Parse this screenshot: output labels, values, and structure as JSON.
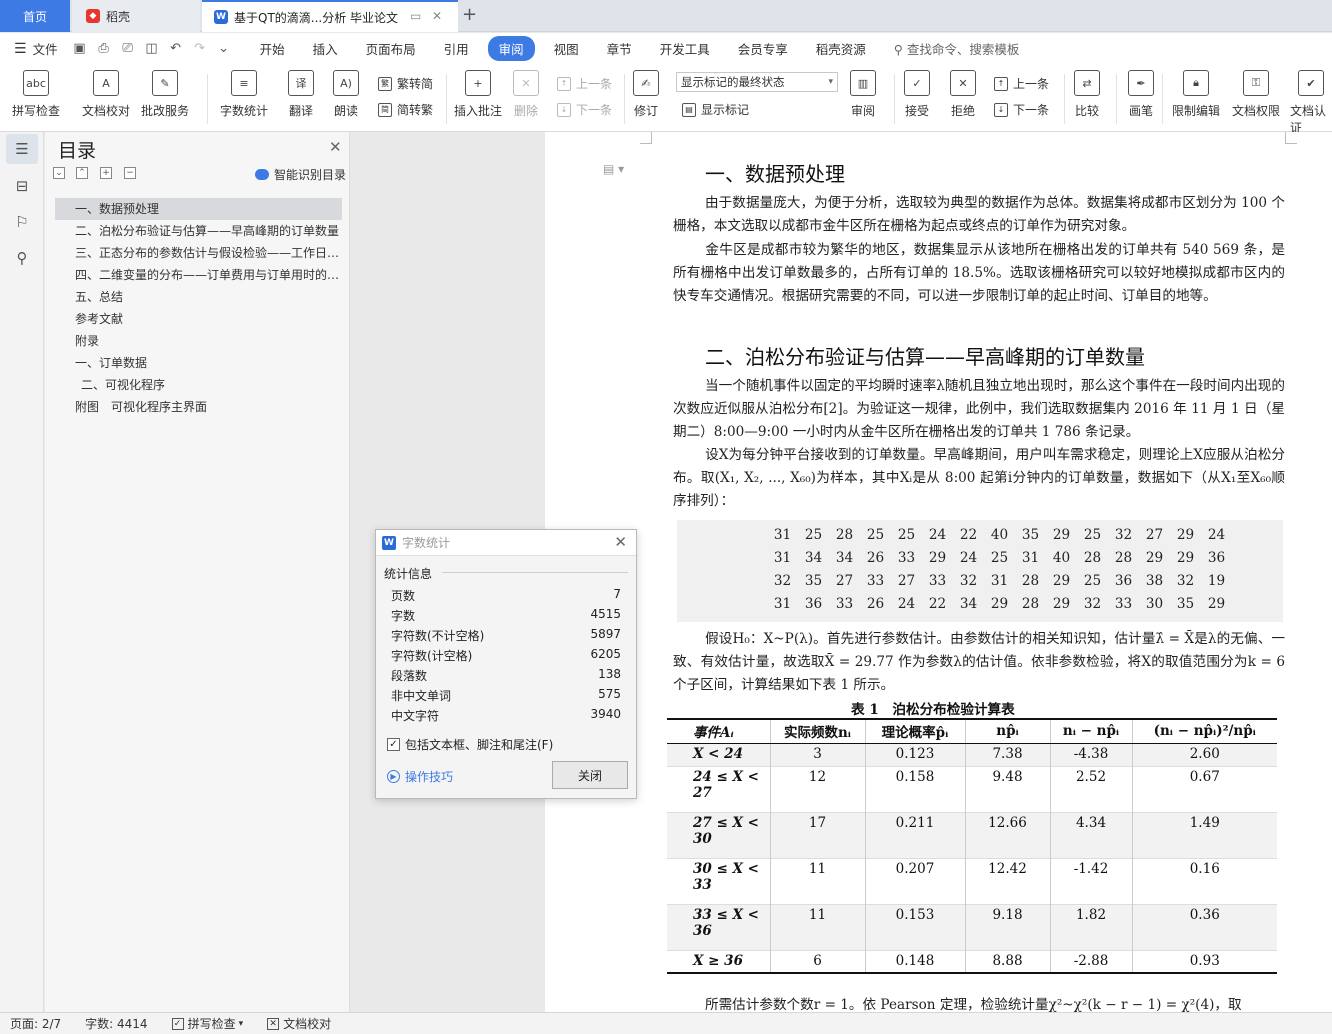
{
  "tabs": {
    "home": "首页",
    "daoke": "稻壳",
    "doc": "基于QT的滴滴...分析 毕业论文",
    "add": "+"
  },
  "menu": {
    "file": "文件",
    "items": [
      "开始",
      "插入",
      "页面布局",
      "引用",
      "审阅",
      "视图",
      "章节",
      "开发工具",
      "会员专享",
      "稻壳资源"
    ],
    "active": "审阅",
    "search": "查找命令、搜索模板"
  },
  "ribbon": {
    "spell_check": "拼写检查",
    "doc_proof": "文档校对",
    "batch_service": "批改服务",
    "word_count": "字数统计",
    "translate": "翻译",
    "read_aloud": "朗读",
    "to_traditional": "繁转简",
    "to_simplified": "简转繁",
    "insert_comment": "插入批注",
    "delete": "删除",
    "prev_comment": "上一条",
    "next_comment": "下一条",
    "revise": "修订",
    "markup_state": "显示标记的最终状态",
    "show_markup": "显示标记",
    "review": "审阅",
    "accept": "接受",
    "reject": "拒绝",
    "prev_change": "上一条",
    "next_change": "下一条",
    "compare": "比较",
    "pen": "画笔",
    "restrict_edit": "限制编辑",
    "doc_permission": "文档权限",
    "doc_auth": "文档认证"
  },
  "toc": {
    "title": "目录",
    "smart": "智能识别目录",
    "items": [
      "一、数据预处理",
      "二、泊松分布验证与估算——早高峰期的订单数量",
      "三、正态分布的参数估计与假设检验——工作日订单用时",
      "四、二维变量的分布——订单费用与订单用时的关系",
      "五、总结",
      "参考文献",
      "附录",
      "一、订单数据",
      "二、可视化程序",
      "附图　可视化程序主界面"
    ]
  },
  "doc": {
    "h1_1": "一、数据预处理",
    "p1": "由于数据量庞大，为便于分析，选取较为典型的数据作为总体。数据集将成都市区划分为 100 个栅格，本文选取以成都市金牛区所在栅格为起点或终点的订单作为研究对象。",
    "p2": "金牛区是成都市较为繁华的地区，数据集显示从该地所在栅格出发的订单共有 540 569 条，是所有栅格中出发订单数最多的，占所有订单的 18.5%。选取该栅格研究可以较好地模拟成都市区内的快专车交通情况。根据研究需要的不同，可以进一步限制订单的起止时间、订单目的地等。",
    "h1_2": "二、泊松分布验证与估算——早高峰期的订单数量",
    "p3": "当一个随机事件以固定的平均瞬时速率λ随机且独立地出现时，那么这个事件在一段时间内出现的次数应近似服从泊松分布[2]。为验证这一规律，此例中，我们选取数据集内 2016 年 11 月 1 日（星期二）8:00—9:00 一小时内从金牛区所在栅格出发的订单共 1 786 条记录。",
    "p4": "设X为每分钟平台接收到的订单数量。早高峰期间，用户叫车需求稳定，则理论上X应服从泊松分布。取(X₁, X₂, ..., X₆₀)为样本，其中Xᵢ是从 8:00 起第i分钟内的订单数量，数据如下（从X₁至X₆₀顺序排列）：",
    "data_rows": [
      [
        "31",
        "25",
        "28",
        "25",
        "25",
        "24",
        "22",
        "40",
        "35",
        "29",
        "25",
        "32",
        "27",
        "29",
        "24"
      ],
      [
        "31",
        "34",
        "34",
        "26",
        "33",
        "29",
        "24",
        "25",
        "31",
        "40",
        "28",
        "28",
        "29",
        "29",
        "36"
      ],
      [
        "32",
        "35",
        "27",
        "33",
        "27",
        "33",
        "32",
        "31",
        "28",
        "29",
        "25",
        "36",
        "38",
        "32",
        "19"
      ],
      [
        "31",
        "36",
        "33",
        "26",
        "24",
        "22",
        "34",
        "29",
        "28",
        "29",
        "32",
        "33",
        "30",
        "35",
        "29"
      ]
    ],
    "p5": "假设H₀：X~P(λ)。首先进行参数估计。由参数估计的相关知识知，估计量λ̂ = X̄是λ的无偏、一致、有效估计量，故选取X̄ = 29.77 作为参数λ的估计值。依非参数检验，将X的取值范围分为k = 6 个子区间，计算结果如下表 1 所示。",
    "table_caption": "表 1　泊松分布检验计算表",
    "table_headers": [
      "事件Aᵢ",
      "实际频数nᵢ",
      "理论概率p̂ᵢ",
      "np̂ᵢ",
      "nᵢ − np̂ᵢ",
      "(nᵢ − np̂ᵢ)²/np̂ᵢ"
    ],
    "table_rows": [
      [
        "X < 24",
        "3",
        "0.123",
        "7.38",
        "-4.38",
        "2.60"
      ],
      [
        "24 ≤ X < 27",
        "12",
        "0.158",
        "9.48",
        "2.52",
        "0.67"
      ],
      [
        "27 ≤ X < 30",
        "17",
        "0.211",
        "12.66",
        "4.34",
        "1.49"
      ],
      [
        "30 ≤ X < 33",
        "11",
        "0.207",
        "12.42",
        "-1.42",
        "0.16"
      ],
      [
        "33 ≤ X < 36",
        "11",
        "0.153",
        "9.18",
        "1.82",
        "0.36"
      ],
      [
        "X ≥ 36",
        "6",
        "0.148",
        "8.88",
        "-2.88",
        "0.93"
      ]
    ],
    "p6": "所需估计参数个数r = 1。依 Pearson 定理，检验统计量χ²~χ²(k − r − 1) = χ²(4)，取"
  },
  "wordcount": {
    "title": "字数统计",
    "group": "统计信息",
    "rows": [
      {
        "label": "页数",
        "value": "7"
      },
      {
        "label": "字数",
        "value": "4515"
      },
      {
        "label": "字符数(不计空格)",
        "value": "5897"
      },
      {
        "label": "字符数(计空格)",
        "value": "6205"
      },
      {
        "label": "段落数",
        "value": "138"
      },
      {
        "label": "非中文单词",
        "value": "575"
      },
      {
        "label": "中文字符",
        "value": "3940"
      }
    ],
    "include_label": "包括文本框、脚注和尾注(F)",
    "tips": "操作技巧",
    "close": "关闭"
  },
  "status": {
    "page": "页面: 2/7",
    "words": "字数: 4414",
    "spell": "拼写检查",
    "proof": "文档校对"
  }
}
